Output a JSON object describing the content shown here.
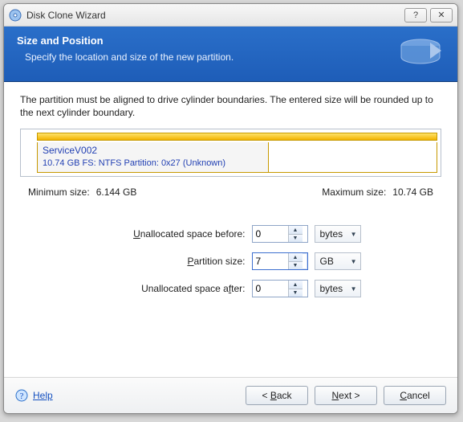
{
  "window": {
    "title": "Disk Clone Wizard"
  },
  "header": {
    "title": "Size and Position",
    "description": "Specify the location and size of the new partition."
  },
  "instruction": "The partition must be aligned to drive cylinder boundaries. The entered size will be rounded up to the next cylinder boundary.",
  "partition": {
    "name": "ServiceV002",
    "detail": "10.74 GB  FS: NTFS Partition: 0x27 (Unknown)"
  },
  "sizes": {
    "min_label": "Minimum size:",
    "min_value": "6.144 GB",
    "max_label": "Maximum size:",
    "max_value": "10.74 GB"
  },
  "form": {
    "before_label_pre": "U",
    "before_label_rest": "nallocated space before:",
    "before_value": "0",
    "before_unit": "bytes",
    "size_label_pre": "P",
    "size_label_rest": "artition size:",
    "size_value": "7",
    "size_unit": "GB",
    "after_label_pre": "Unallocated space a",
    "after_label_ul": "f",
    "after_label_post": "ter:",
    "after_value": "0",
    "after_unit": "bytes"
  },
  "footer": {
    "help": "Help",
    "back": "< Back",
    "next": "Next >",
    "cancel": "Cancel"
  }
}
